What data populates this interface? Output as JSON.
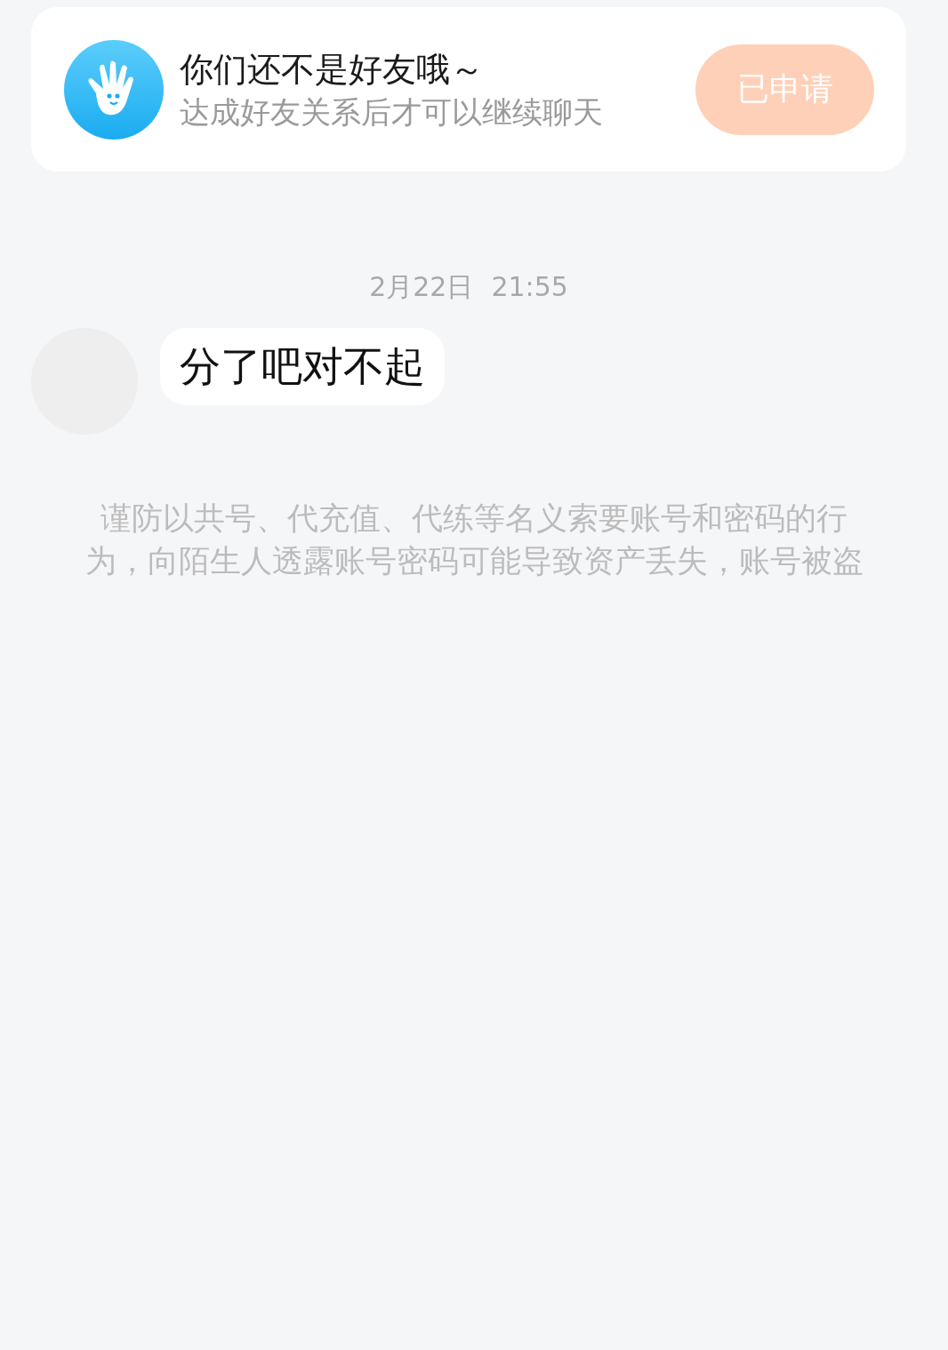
{
  "friend_banner": {
    "title": "你们还不是好友哦～",
    "subtitle": "达成好友关系后才可以继续聊天",
    "button": {
      "label": "已申请",
      "disabled": true
    }
  },
  "timestamp": {
    "date": "2月22日",
    "time": "21:55"
  },
  "messages": [
    {
      "text": "分了吧对不起"
    }
  ],
  "notice_lines": [
    "谨防以共号、代充值、代练等名义索要账号和密码的行",
    "为，向陌生人透露账号密码可能导致资产丢失，账号被盗"
  ]
}
